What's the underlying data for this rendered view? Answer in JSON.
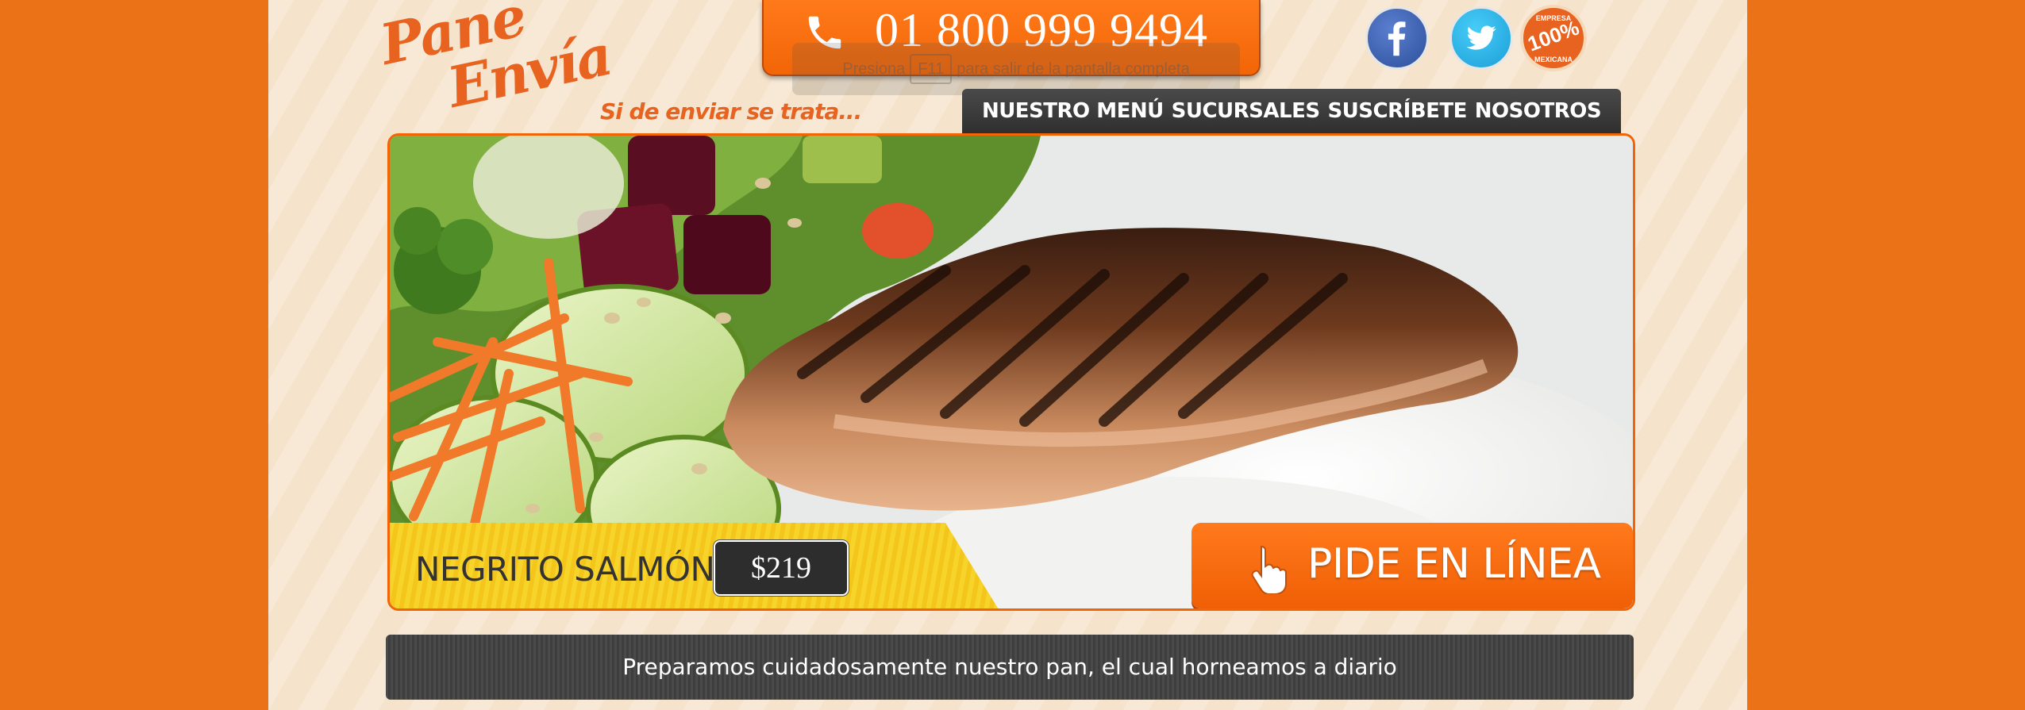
{
  "brand": {
    "logo_line1": "Pane",
    "logo_line2": "Envía",
    "tagline": "Si de enviar se trata...",
    "accent_color": "#ec7217"
  },
  "header": {
    "phone_number": "01 800 999 9494",
    "fullscreen_hint": {
      "prefix": "Presiona",
      "key": "F11",
      "suffix": "para salir de la pantalla completa"
    }
  },
  "social": {
    "facebook_icon": "facebook-icon",
    "twitter_icon": "twitter-icon",
    "badge": {
      "top": "EMPRESA",
      "value": "100%",
      "bottom": "MEXICANA"
    }
  },
  "nav": {
    "items": [
      {
        "label": "NUESTRO MENÚ"
      },
      {
        "label": "SUCURSALES"
      },
      {
        "label": "SUSCRÍBETE"
      },
      {
        "label": "NOSOTROS"
      }
    ]
  },
  "hero": {
    "dish_name": "NEGRITO SALMÓN",
    "price": "$219",
    "order_label": "PIDE EN LÍNEA",
    "order_icon": "pointing-hand-icon"
  },
  "footer": {
    "message": "Preparamos cuidadosamente nuestro pan, el cual horneamos a diario"
  }
}
